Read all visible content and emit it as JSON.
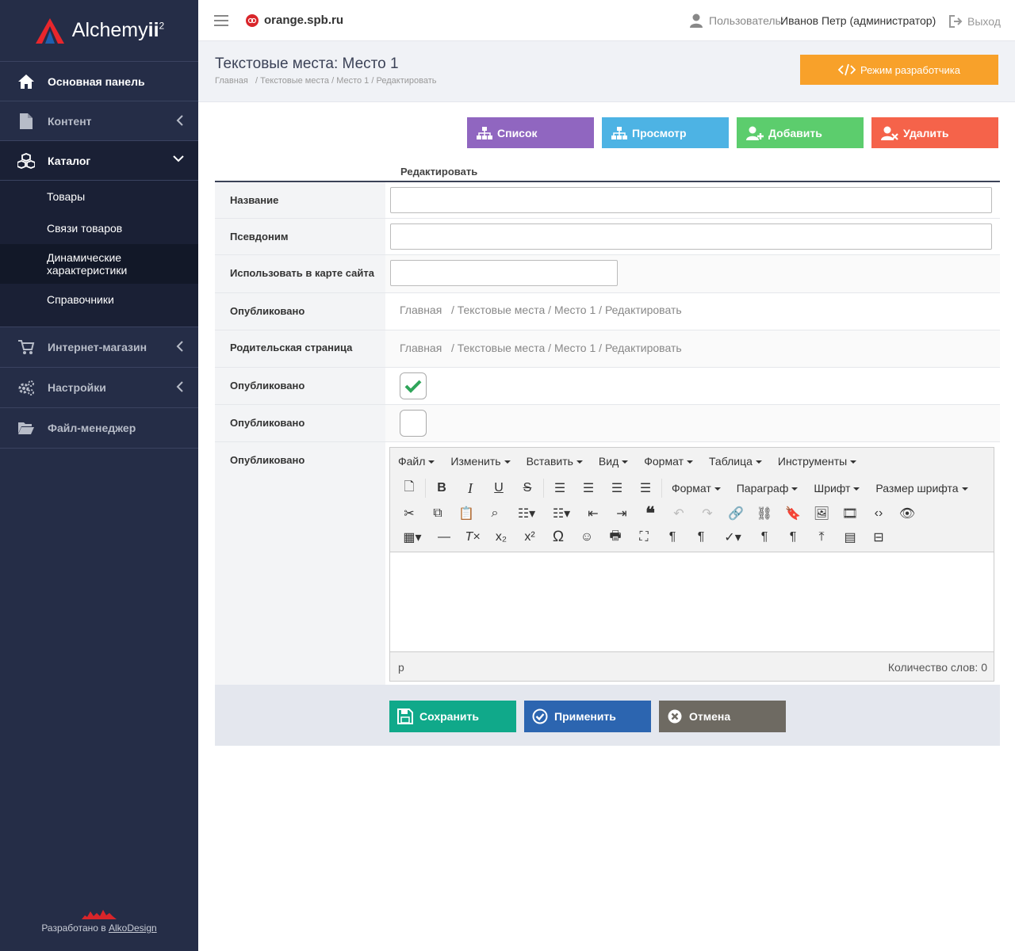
{
  "brand": {
    "name_prefix": "Alchemy",
    "name_suffix": "ii",
    "sup": "2"
  },
  "sidebar": {
    "items": [
      {
        "label": "Основная панель"
      },
      {
        "label": "Контент"
      },
      {
        "label": "Каталог"
      },
      {
        "label": "Интернет-магазин"
      },
      {
        "label": "Настройки"
      },
      {
        "label": "Файл-менеджер"
      }
    ],
    "catalog_sub": [
      {
        "label": "Товары"
      },
      {
        "label": "Связи товаров"
      },
      {
        "label": "Динамические характеристики"
      },
      {
        "label": "Справочники"
      }
    ],
    "credit_prefix": "Разработано в",
    "credit_link": "AlkoDesign"
  },
  "topbar": {
    "site": "orange.spb.ru",
    "user_label": "Пользователь:",
    "user_name": "Иванов Петр (администратор)",
    "logout": "Выход"
  },
  "page": {
    "title": "Текстовые места: Место 1",
    "breadcrumb": [
      "Главная",
      "Текстовые места",
      "Место 1",
      "Редактировать"
    ],
    "dev_mode": "Режим разработчика"
  },
  "actions": {
    "list": "Список",
    "view": "Просмотр",
    "add": "Добавить",
    "delete": "Удалить"
  },
  "form": {
    "header": "Редактировать",
    "rows": [
      {
        "label": "Название"
      },
      {
        "label": "Псевдоним"
      },
      {
        "label": "Использовать в карте сайта"
      },
      {
        "label": "Опубликовано"
      },
      {
        "label": "Родительская страница"
      },
      {
        "label": "Опубликовано",
        "checked": true
      },
      {
        "label": "Опубликовано",
        "checked": false
      },
      {
        "label": "Опубликовано"
      }
    ],
    "bc_sep": "/"
  },
  "editor": {
    "menu": [
      "Файл",
      "Изменить",
      "Вставить",
      "Вид",
      "Формат",
      "Таблица",
      "Инструменты"
    ],
    "dropdowns": [
      "Формат",
      "Параграф",
      "Шрифт",
      "Размер шрифта"
    ],
    "path": "p",
    "wordcount": "Количество слов: 0"
  },
  "buttons": {
    "save": "Сохранить",
    "apply": "Применить",
    "cancel": "Отмена"
  },
  "colors": {
    "sidebar": "#252d47",
    "list": "#9066c0",
    "view": "#4db3e4",
    "add": "#5ccd6d",
    "delete": "#f5634a",
    "dev": "#f8a12a",
    "save": "#10a98a",
    "apply": "#2c65b0",
    "cancel": "#6e6a62"
  }
}
